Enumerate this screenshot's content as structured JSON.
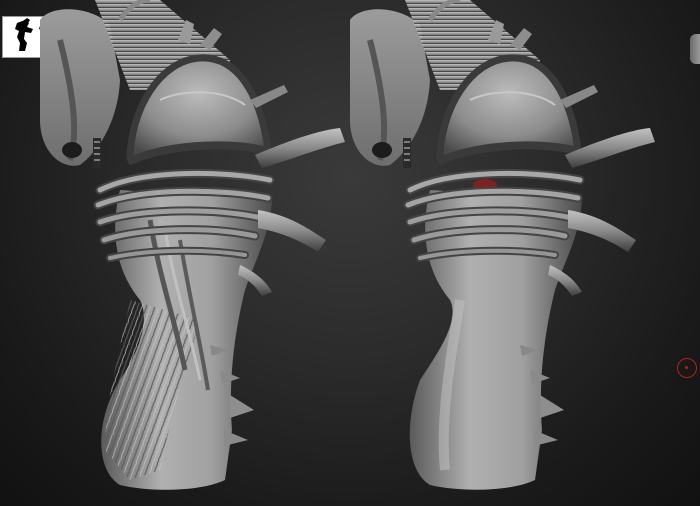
{
  "app": {
    "title": ""
  },
  "viewport": {
    "background_color": "#1f1f1f",
    "model_color": "#8a8a8a",
    "highlight_color": "#bdbdbd",
    "shadow_color": "#3c3c3c",
    "mask_color": "#8b1e1e"
  },
  "navigator": {
    "icon": "silhouette-preview-icon",
    "background": "#ffffff",
    "silhouette_color": "#000000"
  },
  "models": [
    {
      "id": "detailed-sculpt",
      "state": "high-detail"
    },
    {
      "id": "smoothed-sculpt",
      "state": "smoothed"
    }
  ],
  "brush_cursor": {
    "icon": "brush-circle-icon",
    "color": "#b21f1f"
  }
}
